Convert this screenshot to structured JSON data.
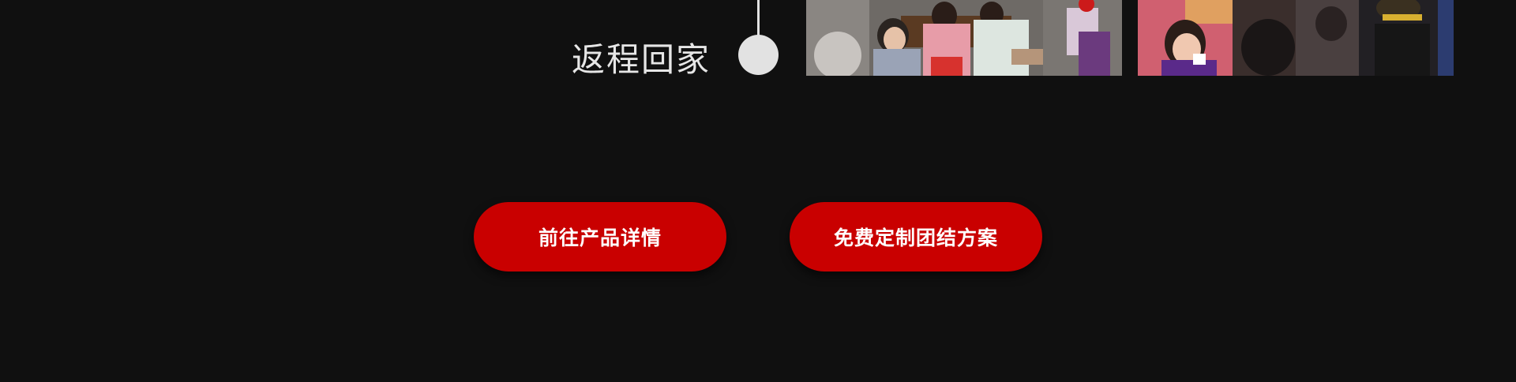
{
  "timeline": {
    "step_label": "返程回家"
  },
  "photos": [
    {
      "name": "group-dining-photo"
    },
    {
      "name": "festival-costume-photo"
    }
  ],
  "buttons": {
    "product_details": "前往产品详情",
    "custom_plan": "免费定制团结方案"
  },
  "colors": {
    "background": "#101010",
    "accent": "#c90000",
    "timeline": "#e2e2e2"
  }
}
